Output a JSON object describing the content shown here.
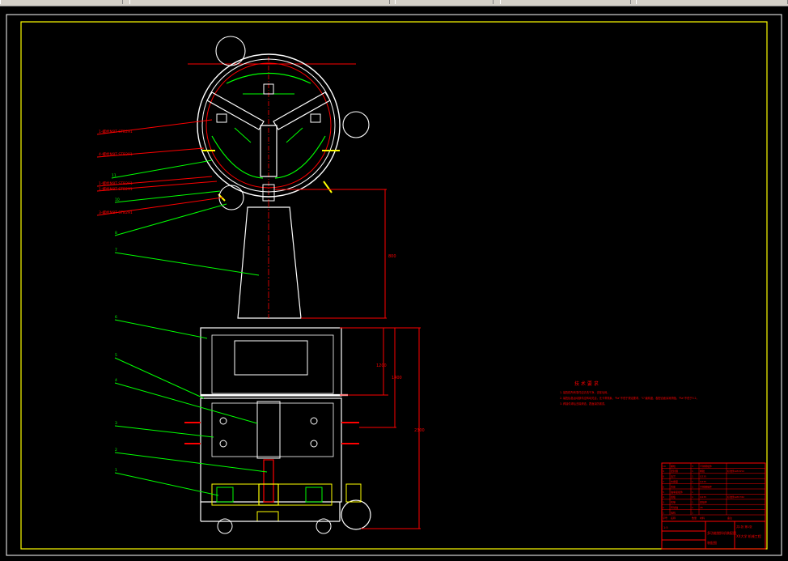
{
  "colors": {
    "background": "#000000",
    "frame": "#ffffff",
    "inner_frame": "#ffff00",
    "part": "#ffffff",
    "leader": "#00ff00",
    "dimension": "#ff0000",
    "centerline": "#ff0000",
    "toolbar": "#d4d0c8"
  },
  "toolbar": {
    "tabs": [
      "",
      "",
      "",
      "",
      ""
    ]
  },
  "callouts_left": [
    {
      "id": "c1",
      "label": "1-螺栓M8T STB291"
    },
    {
      "id": "c2",
      "label": "4-螺栓M8T STB291"
    },
    {
      "id": "c3",
      "label": "11"
    },
    {
      "id": "c4",
      "label": "1-螺栓M8T STB291"
    },
    {
      "id": "c5",
      "label": "1-螺栓M8T STB291"
    },
    {
      "id": "c6",
      "label": "10"
    },
    {
      "id": "c7",
      "label": "3-螺栓M8T STB291"
    },
    {
      "id": "c8",
      "label": "8"
    },
    {
      "id": "c9",
      "label": "7"
    },
    {
      "id": "c10",
      "label": "6"
    },
    {
      "id": "c11",
      "label": "5"
    },
    {
      "id": "c12",
      "label": "4"
    },
    {
      "id": "c13",
      "label": "3"
    },
    {
      "id": "c14",
      "label": "2"
    },
    {
      "id": "c15",
      "label": "1"
    }
  ],
  "dimensions": {
    "upper_height": "800",
    "mid_height": "1200",
    "lower_height": "1400",
    "total_height": "2300"
  },
  "tech_notes": {
    "title": "技 术 要 求",
    "lines": [
      "1. 装配前所有零件应清洗干净，去除毛刺。",
      "2. 装配后各运动部件应转动灵活，无卡滞现象，\"Ra\"不低于规定要求，\"C\"级精度，各配合面涂润滑脂，\"Ra\"不低于3.2。",
      "3. 焊接件焊后去除焊渣，表面涂防锈漆。"
    ]
  },
  "title_block": {
    "bom_rows": [
      {
        "no": "10",
        "name": "螺栓",
        "qty": "3",
        "material": "不锈钢组件",
        "note": ""
      },
      {
        "no": "9",
        "name": "密封圈",
        "qty": "1",
        "material": "橡胶",
        "note": "标准件GB3452"
      },
      {
        "no": "8",
        "name": "法兰",
        "qty": "1",
        "material": "Q235",
        "note": ""
      },
      {
        "no": "7",
        "name": "支撑座",
        "qty": "1",
        "material": "Q235",
        "note": ""
      },
      {
        "no": "6",
        "name": "壳体",
        "qty": "1",
        "material": "不锈钢组件",
        "note": ""
      },
      {
        "no": "5",
        "name": "轴承座组件",
        "qty": "1",
        "material": "",
        "note": ""
      },
      {
        "no": "4",
        "name": "挡板",
        "qty": "1",
        "material": "Q235",
        "note": "标准件GB5782"
      },
      {
        "no": "3",
        "name": "机架",
        "qty": "1",
        "material": "焊接件",
        "note": ""
      },
      {
        "no": "2",
        "name": "传动轴",
        "qty": "1",
        "material": "45",
        "note": ""
      },
      {
        "no": "1",
        "name": "电机",
        "qty": "1",
        "material": "",
        "note": ""
      }
    ],
    "header": [
      "序号",
      "名称",
      "数量",
      "材料",
      "备注"
    ],
    "drawing_name": "多功能搅拌机装配图",
    "drawing_no": "装配图",
    "school": "XX大学 机械工程",
    "scale": "1:5",
    "sheet": "共1张 第1张"
  }
}
